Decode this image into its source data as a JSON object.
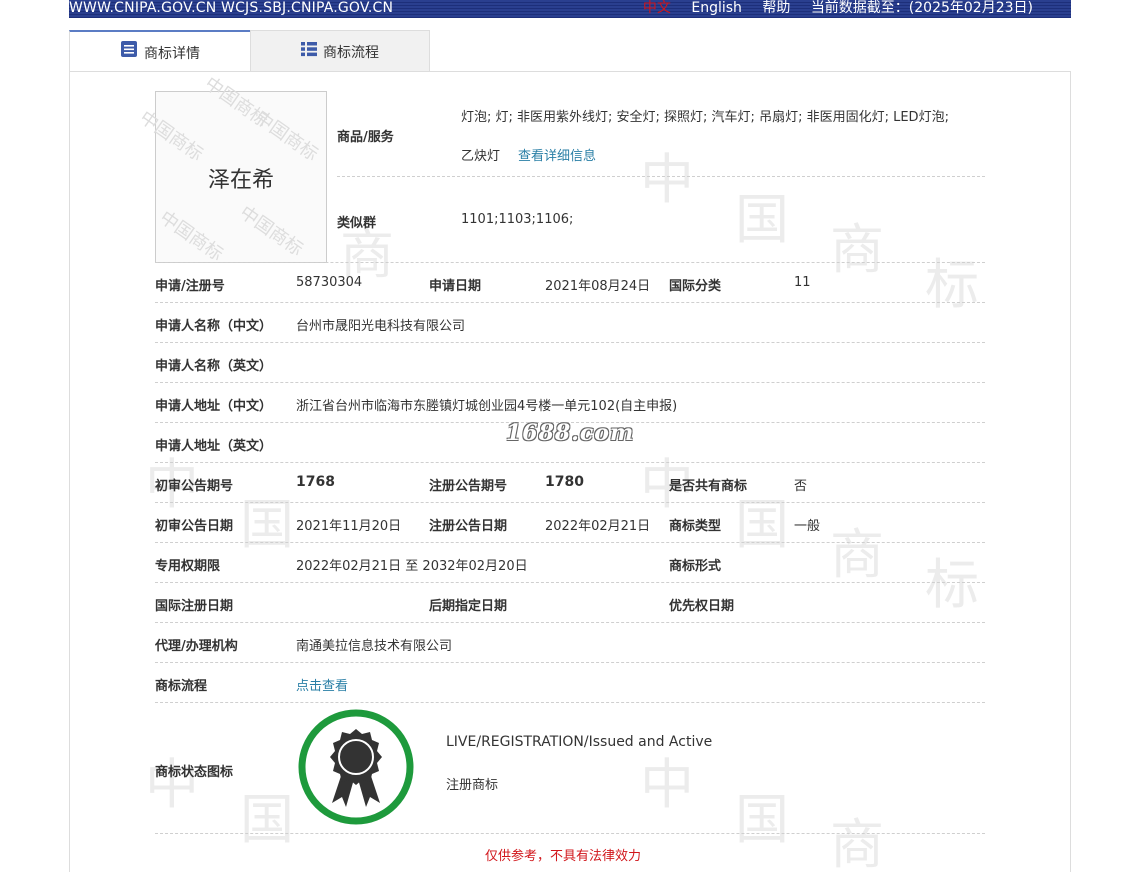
{
  "topbar": {
    "sites": "WWW.CNIPA.GOV.CN WCJS.SBJ.CNIPA.GOV.CN",
    "lang_cn": "中文",
    "lang_en": "English",
    "help": "帮助",
    "data_as_of": "当前数据截至：(2025年02月23日)"
  },
  "tabs": [
    {
      "label": "商标详情",
      "icon": "document-icon",
      "active": true
    },
    {
      "label": "商标流程",
      "icon": "list-icon",
      "active": false
    }
  ],
  "mark": {
    "text": "泽在希",
    "watermark": "中国商标"
  },
  "goods": {
    "label": "商品/服务",
    "value_line1": "灯泡; 灯; 非医用紫外线灯; 安全灯; 探照灯; 汽车灯; 吊扇灯; 非医用固化灯; LED灯泡;",
    "value_line2": "乙炔灯",
    "detail_link": "查看详细信息"
  },
  "similar_group": {
    "label": "类似群",
    "value": "1101;1103;1106;"
  },
  "rows": {
    "reg_no_label": "申请/注册号",
    "reg_no": "58730304",
    "apply_date_label": "申请日期",
    "apply_date": "2021年08月24日",
    "intl_class_label": "国际分类",
    "intl_class": "11",
    "applicant_cn_label": "申请人名称（中文）",
    "applicant_cn": "台州市晟阳光电科技有限公司",
    "applicant_en_label": "申请人名称（英文）",
    "applicant_en": "",
    "address_cn_label": "申请人地址（中文）",
    "address_cn": "浙江省台州市临海市东塍镇灯城创业园4号楼一单元102(自主申报)",
    "address_en_label": "申请人地址（英文）",
    "address_en": "",
    "prelim_no_label": "初审公告期号",
    "prelim_no": "1768",
    "reg_pub_no_label": "注册公告期号",
    "reg_pub_no": "1780",
    "shared_label": "是否共有商标",
    "shared": "否",
    "prelim_date_label": "初审公告日期",
    "prelim_date": "2021年11月20日",
    "reg_pub_date_label": "注册公告日期",
    "reg_pub_date": "2022年02月21日",
    "mark_type_label": "商标类型",
    "mark_type": "一般",
    "term_label": "专用权期限",
    "term": "2022年02月21日 至 2032年02月20日",
    "mark_form_label": "商标形式",
    "mark_form": "",
    "intl_reg_date_label": "国际注册日期",
    "intl_reg_date": "",
    "later_designation_label": "后期指定日期",
    "later_designation": "",
    "priority_date_label": "优先权日期",
    "priority_date": "",
    "agent_label": "代理/办理机构",
    "agent": "南通美拉信息技术有限公司",
    "flow_label": "商标流程",
    "flow_link": "点击查看",
    "status_icon_label": "商标状态图标",
    "status_en": "LIVE/REGISTRATION/Issued and Active",
    "status_cn": "注册商标"
  },
  "notice": "仅供参考，不具有法律效力",
  "overlay_site": "1688.com",
  "colors": {
    "topbar": "#233782",
    "link": "#2a7fa6",
    "badge_ring": "#1e9a3c",
    "notice": "#d1161b"
  }
}
